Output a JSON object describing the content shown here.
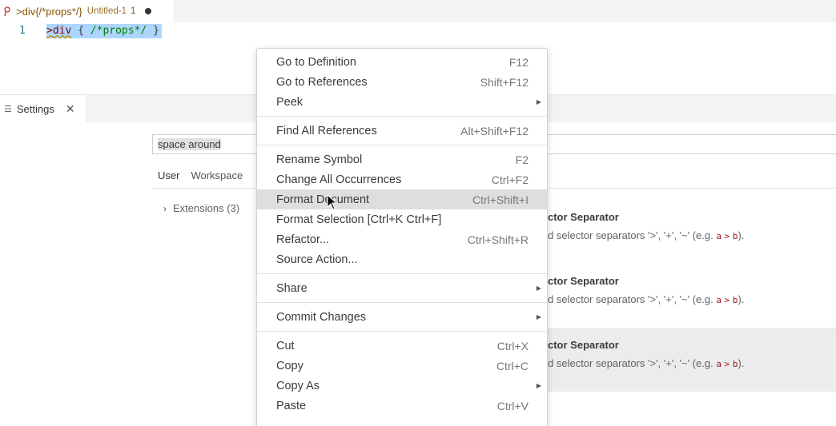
{
  "editor": {
    "tab": {
      "title": ">div{/*props*/}",
      "path": "Untitled-1",
      "problem_count": "1",
      "dirty": true
    },
    "line_number": "1",
    "code": {
      "open": ">",
      "tag": "div",
      "space1": " ",
      "brace_open": "{",
      "space2": " ",
      "comment": "/*props*/",
      "space3": " ",
      "brace_close": "}"
    }
  },
  "settings": {
    "tab_label": "Settings",
    "search_value": "space around",
    "scope_tabs": [
      {
        "label": "User"
      },
      {
        "label": "Workspace"
      }
    ],
    "toc": [
      {
        "label": "Extensions (3)"
      }
    ],
    "items": [
      {
        "title": "ctor Separator",
        "desc": "d selector separators '>', '+', '~' (e.g. ",
        "code1": "a",
        "gt": ">",
        "code2": "b",
        "tail": ")."
      },
      {
        "title": "ctor Separator",
        "desc": "d selector separators '>', '+', '~' (e.g. ",
        "code1": "a",
        "gt": ">",
        "code2": "b",
        "tail": ")."
      },
      {
        "title": "ctor Separator",
        "desc": "d selector separators '>', '+', '~' (e.g. ",
        "code1": "a",
        "gt": ">",
        "code2": "b",
        "tail": ")."
      }
    ]
  },
  "context_menu": {
    "groups": [
      [
        {
          "label": "Go to Definition",
          "key": "F12"
        },
        {
          "label": "Go to References",
          "key": "Shift+F12"
        },
        {
          "label": "Peek",
          "key": "",
          "submenu": true
        }
      ],
      [
        {
          "label": "Find All References",
          "key": "Alt+Shift+F12"
        }
      ],
      [
        {
          "label": "Rename Symbol",
          "key": "F2"
        },
        {
          "label": "Change All Occurrences",
          "key": "Ctrl+F2"
        },
        {
          "label": "Format Document",
          "key": "Ctrl+Shift+I",
          "highlighted": true
        },
        {
          "label": "Format Selection [Ctrl+K Ctrl+F]",
          "key": ""
        },
        {
          "label": "Refactor...",
          "key": "Ctrl+Shift+R"
        },
        {
          "label": "Source Action...",
          "key": ""
        }
      ],
      [
        {
          "label": "Share",
          "key": "",
          "submenu": true
        }
      ],
      [
        {
          "label": "Commit Changes",
          "key": "",
          "submenu": true
        }
      ],
      [
        {
          "label": "Cut",
          "key": "Ctrl+X"
        },
        {
          "label": "Copy",
          "key": "Ctrl+C"
        },
        {
          "label": "Copy As",
          "key": "",
          "submenu": true
        },
        {
          "label": "Paste",
          "key": "Ctrl+V"
        }
      ]
    ]
  },
  "icons": {
    "file_icon": "react-file-icon",
    "settings_icon": "list-icon",
    "close_icon": "close-icon",
    "chevron": "chevron-right-icon",
    "submenu": "triangle-right-icon",
    "cursor": "mouse-pointer-icon"
  },
  "colors": {
    "selection": "#add6ff",
    "menu_highlight": "#dedede",
    "tab_warning_text": "#895503",
    "line_number": "#237893"
  }
}
